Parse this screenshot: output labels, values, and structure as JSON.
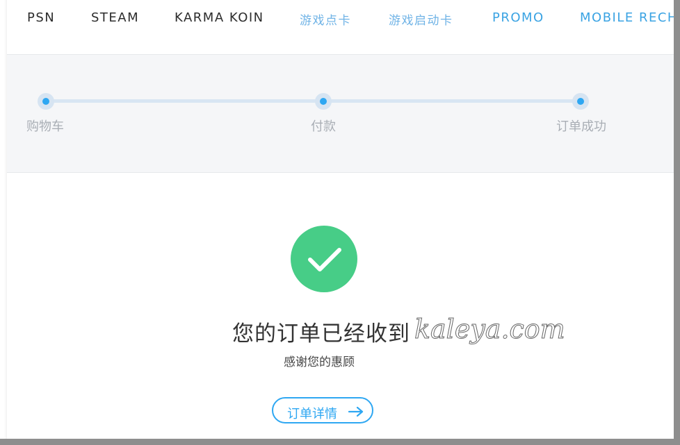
{
  "nav": {
    "items": [
      "PSN",
      "STEAM",
      "KARMA KOIN",
      "游戏点卡",
      "游戏启动卡",
      "PROMO",
      "MOBILE RECH"
    ]
  },
  "steps": [
    {
      "label": "购物车"
    },
    {
      "label": "付款"
    },
    {
      "label": "订单成功"
    }
  ],
  "result": {
    "title": "您的订单已经收到",
    "watermark": "kaleya.com",
    "subtitle": "感谢您的惠顾",
    "button_label": "订单详情"
  },
  "colors": {
    "accent": "#2ea7f2",
    "success": "#47cd87",
    "nav_dark": "#2c2c2c",
    "nav_blue": "#3aa3e3"
  },
  "icons": {
    "success": "check-icon",
    "button": "arrow-right-icon"
  }
}
